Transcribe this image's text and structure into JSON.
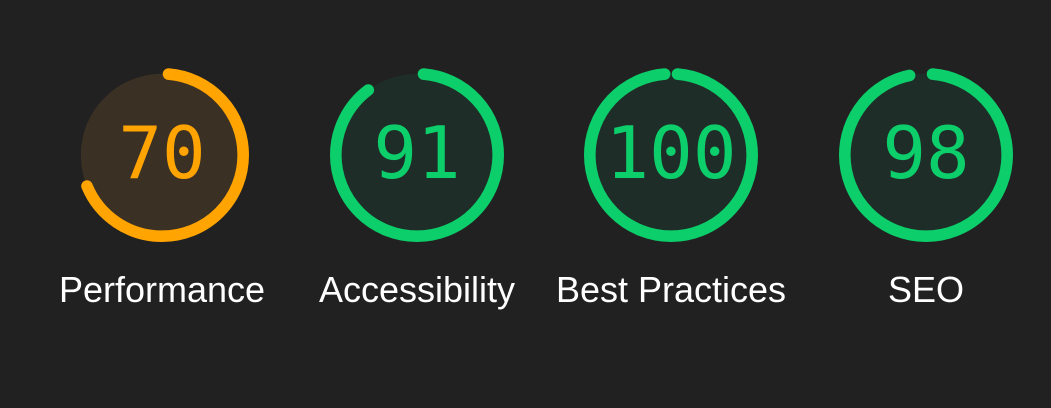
{
  "colors": {
    "pass": "#0cce6b",
    "pass_fill": "#1e2d27",
    "average": "#ffa400",
    "average_fill": "#3a3024"
  },
  "categories": [
    {
      "label": "Performance",
      "score": "70",
      "fraction": 0.7,
      "rating": "average"
    },
    {
      "label": "Accessibility",
      "score": "91",
      "fraction": 0.91,
      "rating": "pass"
    },
    {
      "label": "Best Practices",
      "score": "100",
      "fraction": 1.0,
      "rating": "pass"
    },
    {
      "label": "SEO",
      "score": "98",
      "fraction": 0.98,
      "rating": "pass"
    }
  ]
}
